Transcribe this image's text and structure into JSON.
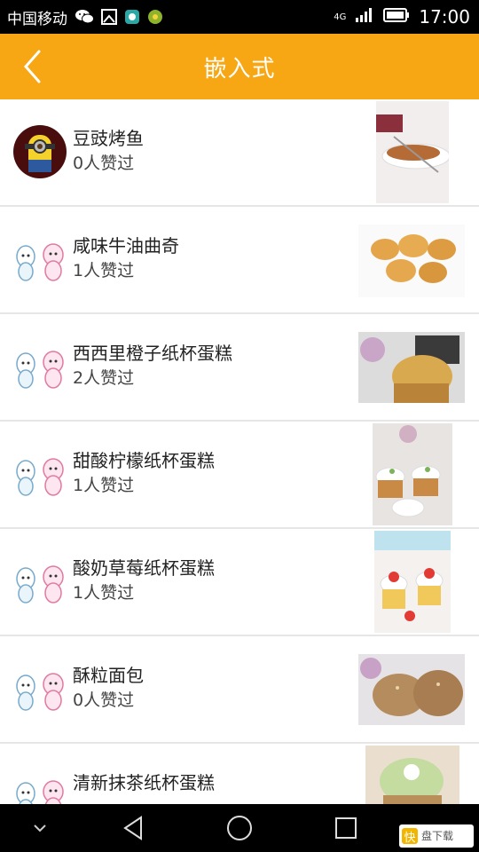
{
  "status_bar": {
    "carrier": "中国移动",
    "network": "4G",
    "time": "17:00"
  },
  "header": {
    "title": "嵌入式",
    "back_icon": "chevron-left-icon"
  },
  "items": [
    {
      "name": "豆豉烤鱼",
      "likes": "0人赞过",
      "avatar": "minion-avatar",
      "image": "grilled-fish"
    },
    {
      "name": "咸味牛油曲奇",
      "likes": "1人赞过",
      "avatar": "cartoon-avatar",
      "image": "butter-cookies"
    },
    {
      "name": "西西里橙子纸杯蛋糕",
      "likes": "2人赞过",
      "avatar": "cartoon-avatar",
      "image": "orange-cupcake"
    },
    {
      "name": "甜酸柠檬纸杯蛋糕",
      "likes": "1人赞过",
      "avatar": "cartoon-avatar",
      "image": "lemon-cupcakes"
    },
    {
      "name": "酸奶草莓纸杯蛋糕",
      "likes": "1人赞过",
      "avatar": "cartoon-avatar",
      "image": "strawberry-cupcakes"
    },
    {
      "name": "酥粒面包",
      "likes": "0人赞过",
      "avatar": "cartoon-avatar",
      "image": "crumb-bread"
    },
    {
      "name": "清新抹茶纸杯蛋糕",
      "likes": "",
      "avatar": "cartoon-avatar",
      "image": "matcha-cupcake"
    }
  ],
  "nav_bar": {
    "icons": [
      "chevron-down-icon",
      "back-triangle-icon",
      "home-circle-icon",
      "recents-square-icon"
    ]
  },
  "watermark": {
    "logo": "快",
    "text": "盘下载"
  },
  "colors": {
    "accent": "#f7a713",
    "status_bar": "#000000",
    "divider": "#e6e6e6"
  }
}
